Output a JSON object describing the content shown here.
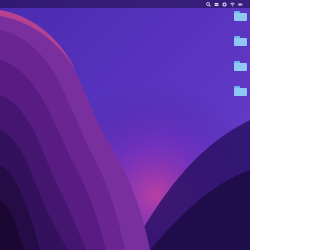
{
  "desktop": {
    "wallpaper": "purple-mountain-waves",
    "colors": {
      "wallpaper_base": "#3b1a8c",
      "wallpaper_glow": "#b23aa8",
      "menubar": "#1e0c46",
      "folder": "#8ec8f3"
    }
  },
  "menubar": {
    "status_icons": [
      "spotlight-icon",
      "control-center-icon",
      "siri-icon",
      "wifi-icon",
      "battery-icon"
    ],
    "clock": ""
  },
  "desktop_items": [
    {
      "label": "",
      "icon": "folder-icon"
    },
    {
      "label": "",
      "icon": "folder-icon"
    },
    {
      "label": "",
      "icon": "folder-icon"
    },
    {
      "label": "",
      "icon": "folder-icon"
    }
  ]
}
